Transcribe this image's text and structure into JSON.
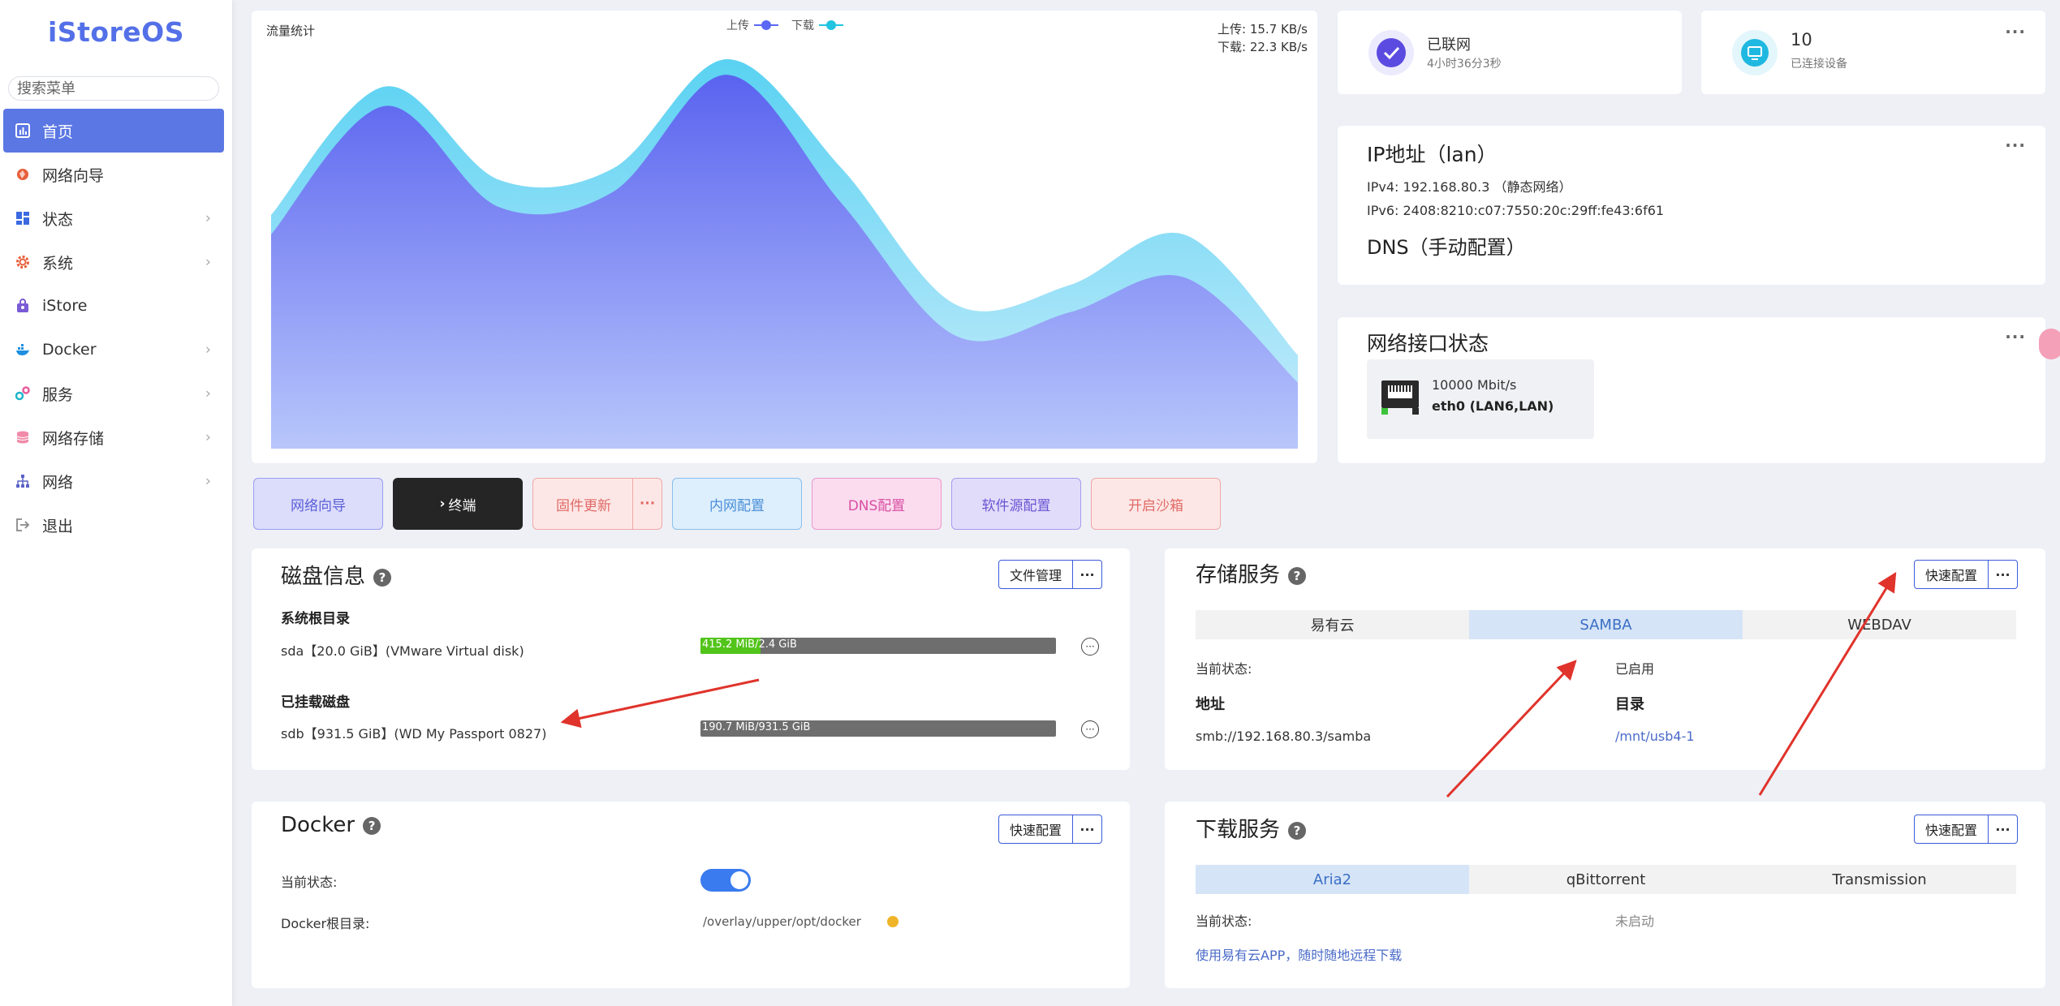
{
  "sidebar": {
    "logo": "iStoreOS",
    "search_placeholder": "搜索菜单",
    "items": [
      {
        "label": "首页",
        "icon": "dashboard-icon"
      },
      {
        "label": "网络向导",
        "icon": "network-wizard-icon"
      },
      {
        "label": "状态",
        "icon": "status-icon"
      },
      {
        "label": "系统",
        "icon": "system-gear-icon"
      },
      {
        "label": "iStore",
        "icon": "store-bag-icon"
      },
      {
        "label": "Docker",
        "icon": "docker-icon"
      },
      {
        "label": "服务",
        "icon": "services-icon"
      },
      {
        "label": "网络存储",
        "icon": "storage-icon"
      },
      {
        "label": "网络",
        "icon": "network-tree-icon"
      },
      {
        "label": "退出",
        "icon": "logout-icon"
      }
    ]
  },
  "traffic": {
    "title": "流量统计",
    "legend_upload": "上传",
    "legend_download": "下载",
    "upload_rate": "上传: 15.7 KB/s",
    "download_rate": "下载: 22.3 KB/s"
  },
  "chart_data": {
    "type": "area",
    "title": "流量统计",
    "series": [
      {
        "name": "上传",
        "values": [
          0.55,
          0.88,
          0.62,
          0.66,
          0.96,
          0.63,
          0.29,
          0.35,
          0.44,
          0.17
        ]
      },
      {
        "name": "下载",
        "values": [
          0.6,
          0.93,
          0.69,
          0.72,
          1.0,
          0.72,
          0.37,
          0.42,
          0.55,
          0.24
        ]
      }
    ],
    "colors": {
      "upload": "#5b67f5",
      "download": "#22c4e0"
    },
    "grid": false
  },
  "status": {
    "connected": "已联网",
    "uptime": "4小时36分3秒",
    "devices_count": "10",
    "devices_label": "已连接设备"
  },
  "ip": {
    "title": "IP地址（lan）",
    "ipv4": "IPv4: 192.168.80.3 （静态网络）",
    "ipv6": "IPv6: 2408:8210:c07:7550:20c:29ff:fe43:6f61",
    "dns": "DNS（手动配置）"
  },
  "net_iface": {
    "title": "网络接口状态",
    "speed": "10000 Mbit/s",
    "name": "eth0 (LAN6,LAN)"
  },
  "quick": {
    "wizard": "网络向导",
    "terminal": "终端",
    "firmware": "固件更新",
    "more": "···",
    "lan": "内网配置",
    "dns": "DNS配置",
    "software": "软件源配置",
    "sandbox": "开启沙箱"
  },
  "disk": {
    "title": "磁盘信息",
    "file_mgr": "文件管理",
    "more": "···",
    "root_title": "系统根目录",
    "root_disk": "sda【20.0 GiB】(VMware Virtual disk)",
    "root_usage": "415.2 MiB/2.4 GiB",
    "root_fraction": 0.17,
    "mounted_title": "已挂载磁盘",
    "mounted_disk": "sdb【931.5 GiB】(WD My Passport 0827)",
    "mounted_usage": "190.7 MiB/931.5 GiB",
    "mounted_fraction": 0.0
  },
  "storage": {
    "title": "存储服务",
    "quick_config": "快速配置",
    "more": "···",
    "tabs": [
      "易有云",
      "SAMBA",
      "WEBDAV"
    ],
    "active_tab": 1,
    "state_label": "当前状态:",
    "state_value": "已启用",
    "addr_label": "地址",
    "dir_label": "目录",
    "addr_value": "smb://192.168.80.3/samba",
    "dir_value": "/mnt/usb4-1"
  },
  "docker": {
    "title": "Docker",
    "quick_config": "快速配置",
    "more": "···",
    "state_label": "当前状态:",
    "enabled": true,
    "root_label": "Docker根目录:",
    "root_value": "/overlay/upper/opt/docker"
  },
  "download": {
    "title": "下载服务",
    "quick_config": "快速配置",
    "more": "···",
    "tabs": [
      "Aria2",
      "qBittorrent",
      "Transmission"
    ],
    "active_tab": 0,
    "state_label": "当前状态:",
    "state_value": "未启动",
    "link": "使用易有云APP，随时随地远程下载"
  },
  "card_menu": "···"
}
